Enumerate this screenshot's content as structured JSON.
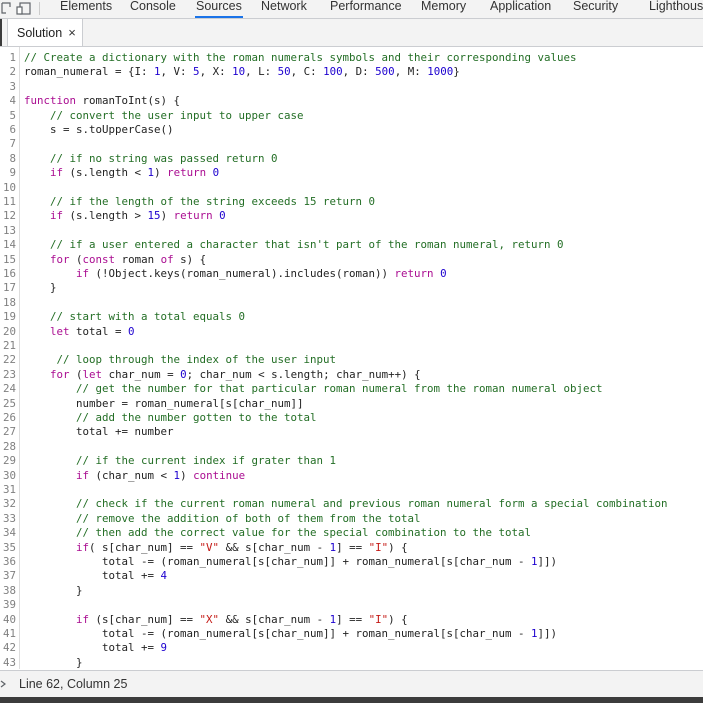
{
  "tabs": [
    {
      "label": "Elements",
      "active": false
    },
    {
      "label": "Console",
      "active": false
    },
    {
      "label": "Sources",
      "active": true
    },
    {
      "label": "Network",
      "active": false
    },
    {
      "label": "Performance",
      "active": false
    },
    {
      "label": "Memory",
      "active": false
    },
    {
      "label": "Application",
      "active": false
    },
    {
      "label": "Security",
      "active": false
    },
    {
      "label": "Lighthouse",
      "active": false
    }
  ],
  "file_tab": {
    "label": "Solution",
    "close_icon": "×"
  },
  "code_lines": [
    [
      [
        "c",
        "// Create a dictionary with the roman numerals symbols and their corresponding values"
      ]
    ],
    [
      [
        "t",
        "roman_numeral = {I: "
      ],
      [
        "n",
        "1"
      ],
      [
        "t",
        ", V: "
      ],
      [
        "n",
        "5"
      ],
      [
        "t",
        ", X: "
      ],
      [
        "n",
        "10"
      ],
      [
        "t",
        ", L: "
      ],
      [
        "n",
        "50"
      ],
      [
        "t",
        ", C: "
      ],
      [
        "n",
        "100"
      ],
      [
        "t",
        ", D: "
      ],
      [
        "n",
        "500"
      ],
      [
        "t",
        ", M: "
      ],
      [
        "n",
        "1000"
      ],
      [
        "t",
        "}"
      ]
    ],
    [],
    [
      [
        "k",
        "function"
      ],
      [
        "t",
        " romanToInt(s) {"
      ]
    ],
    [
      [
        "t",
        "    "
      ],
      [
        "c",
        "// convert the user input to upper case"
      ]
    ],
    [
      [
        "t",
        "    s = s.toUpperCase()"
      ]
    ],
    [],
    [
      [
        "t",
        "    "
      ],
      [
        "c",
        "// if no string was passed return 0"
      ]
    ],
    [
      [
        "t",
        "    "
      ],
      [
        "k",
        "if"
      ],
      [
        "t",
        " (s.length < "
      ],
      [
        "n",
        "1"
      ],
      [
        "t",
        ") "
      ],
      [
        "k",
        "return"
      ],
      [
        "t",
        " "
      ],
      [
        "n",
        "0"
      ]
    ],
    [],
    [
      [
        "t",
        "    "
      ],
      [
        "c",
        "// if the length of the string exceeds 15 return 0"
      ]
    ],
    [
      [
        "t",
        "    "
      ],
      [
        "k",
        "if"
      ],
      [
        "t",
        " (s.length > "
      ],
      [
        "n",
        "15"
      ],
      [
        "t",
        ") "
      ],
      [
        "k",
        "return"
      ],
      [
        "t",
        " "
      ],
      [
        "n",
        "0"
      ]
    ],
    [],
    [
      [
        "t",
        "    "
      ],
      [
        "c",
        "// if a user entered a character that isn't part of the roman numeral, return 0"
      ]
    ],
    [
      [
        "t",
        "    "
      ],
      [
        "k",
        "for"
      ],
      [
        "t",
        " ("
      ],
      [
        "k",
        "const"
      ],
      [
        "t",
        " roman "
      ],
      [
        "k",
        "of"
      ],
      [
        "t",
        " s) {"
      ]
    ],
    [
      [
        "t",
        "        "
      ],
      [
        "k",
        "if"
      ],
      [
        "t",
        " (!Object.keys(roman_numeral).includes(roman)) "
      ],
      [
        "k",
        "return"
      ],
      [
        "t",
        " "
      ],
      [
        "n",
        "0"
      ]
    ],
    [
      [
        "t",
        "    }"
      ]
    ],
    [],
    [
      [
        "t",
        "    "
      ],
      [
        "c",
        "// start with a total equals 0"
      ]
    ],
    [
      [
        "t",
        "    "
      ],
      [
        "k",
        "let"
      ],
      [
        "t",
        " total = "
      ],
      [
        "n",
        "0"
      ]
    ],
    [],
    [
      [
        "t",
        "     "
      ],
      [
        "c",
        "// loop through the index of the user input"
      ]
    ],
    [
      [
        "t",
        "    "
      ],
      [
        "k",
        "for"
      ],
      [
        "t",
        " ("
      ],
      [
        "k",
        "let"
      ],
      [
        "t",
        " char_num = "
      ],
      [
        "n",
        "0"
      ],
      [
        "t",
        "; char_num < s.length; char_num++) {"
      ]
    ],
    [
      [
        "t",
        "        "
      ],
      [
        "c",
        "// get the number for that particular roman numeral from the roman numeral object"
      ]
    ],
    [
      [
        "t",
        "        number = roman_numeral[s[char_num]]"
      ]
    ],
    [
      [
        "t",
        "        "
      ],
      [
        "c",
        "// add the number gotten to the total"
      ]
    ],
    [
      [
        "t",
        "        total += number"
      ]
    ],
    [],
    [
      [
        "t",
        "        "
      ],
      [
        "c",
        "// if the current index if grater than 1"
      ]
    ],
    [
      [
        "t",
        "        "
      ],
      [
        "k",
        "if"
      ],
      [
        "t",
        " (char_num < "
      ],
      [
        "n",
        "1"
      ],
      [
        "t",
        ") "
      ],
      [
        "k",
        "continue"
      ]
    ],
    [],
    [
      [
        "t",
        "        "
      ],
      [
        "c",
        "// check if the current roman numeral and previous roman numeral form a special combination"
      ]
    ],
    [
      [
        "t",
        "        "
      ],
      [
        "c",
        "// remove the addition of both of them from the total"
      ]
    ],
    [
      [
        "t",
        "        "
      ],
      [
        "c",
        "// then add the correct value for the special combination to the total"
      ]
    ],
    [
      [
        "t",
        "        "
      ],
      [
        "k",
        "if"
      ],
      [
        "t",
        "( s[char_num] == "
      ],
      [
        "s",
        "\"V\""
      ],
      [
        "t",
        " && s[char_num - "
      ],
      [
        "n",
        "1"
      ],
      [
        "t",
        "] == "
      ],
      [
        "s",
        "\"I\""
      ],
      [
        "t",
        ") {"
      ]
    ],
    [
      [
        "t",
        "            total -= (roman_numeral[s[char_num]] + roman_numeral[s[char_num - "
      ],
      [
        "n",
        "1"
      ],
      [
        "t",
        "]])"
      ]
    ],
    [
      [
        "t",
        "            total += "
      ],
      [
        "n",
        "4"
      ]
    ],
    [
      [
        "t",
        "        }"
      ]
    ],
    [],
    [
      [
        "t",
        "        "
      ],
      [
        "k",
        "if"
      ],
      [
        "t",
        " (s[char_num] == "
      ],
      [
        "s",
        "\"X\""
      ],
      [
        "t",
        " && s[char_num - "
      ],
      [
        "n",
        "1"
      ],
      [
        "t",
        "] == "
      ],
      [
        "s",
        "\"I\""
      ],
      [
        "t",
        ") {"
      ]
    ],
    [
      [
        "t",
        "            total -= (roman_numeral[s[char_num]] + roman_numeral[s[char_num - "
      ],
      [
        "n",
        "1"
      ],
      [
        "t",
        "]])"
      ]
    ],
    [
      [
        "t",
        "            total += "
      ],
      [
        "n",
        "9"
      ]
    ],
    [
      [
        "t",
        "        }"
      ]
    ]
  ],
  "status": {
    "position": "Line 62, Column 25"
  },
  "colors": {
    "comment": "#236e25",
    "keyword": "#aa0d91",
    "number": "#1c00cf",
    "string": "#c41a16",
    "active_tab_underline": "#1a73e8"
  },
  "icons": [
    "inspect-element-icon",
    "device-toolbar-icon",
    "close-icon",
    "sidebar-toggle-icon"
  ]
}
